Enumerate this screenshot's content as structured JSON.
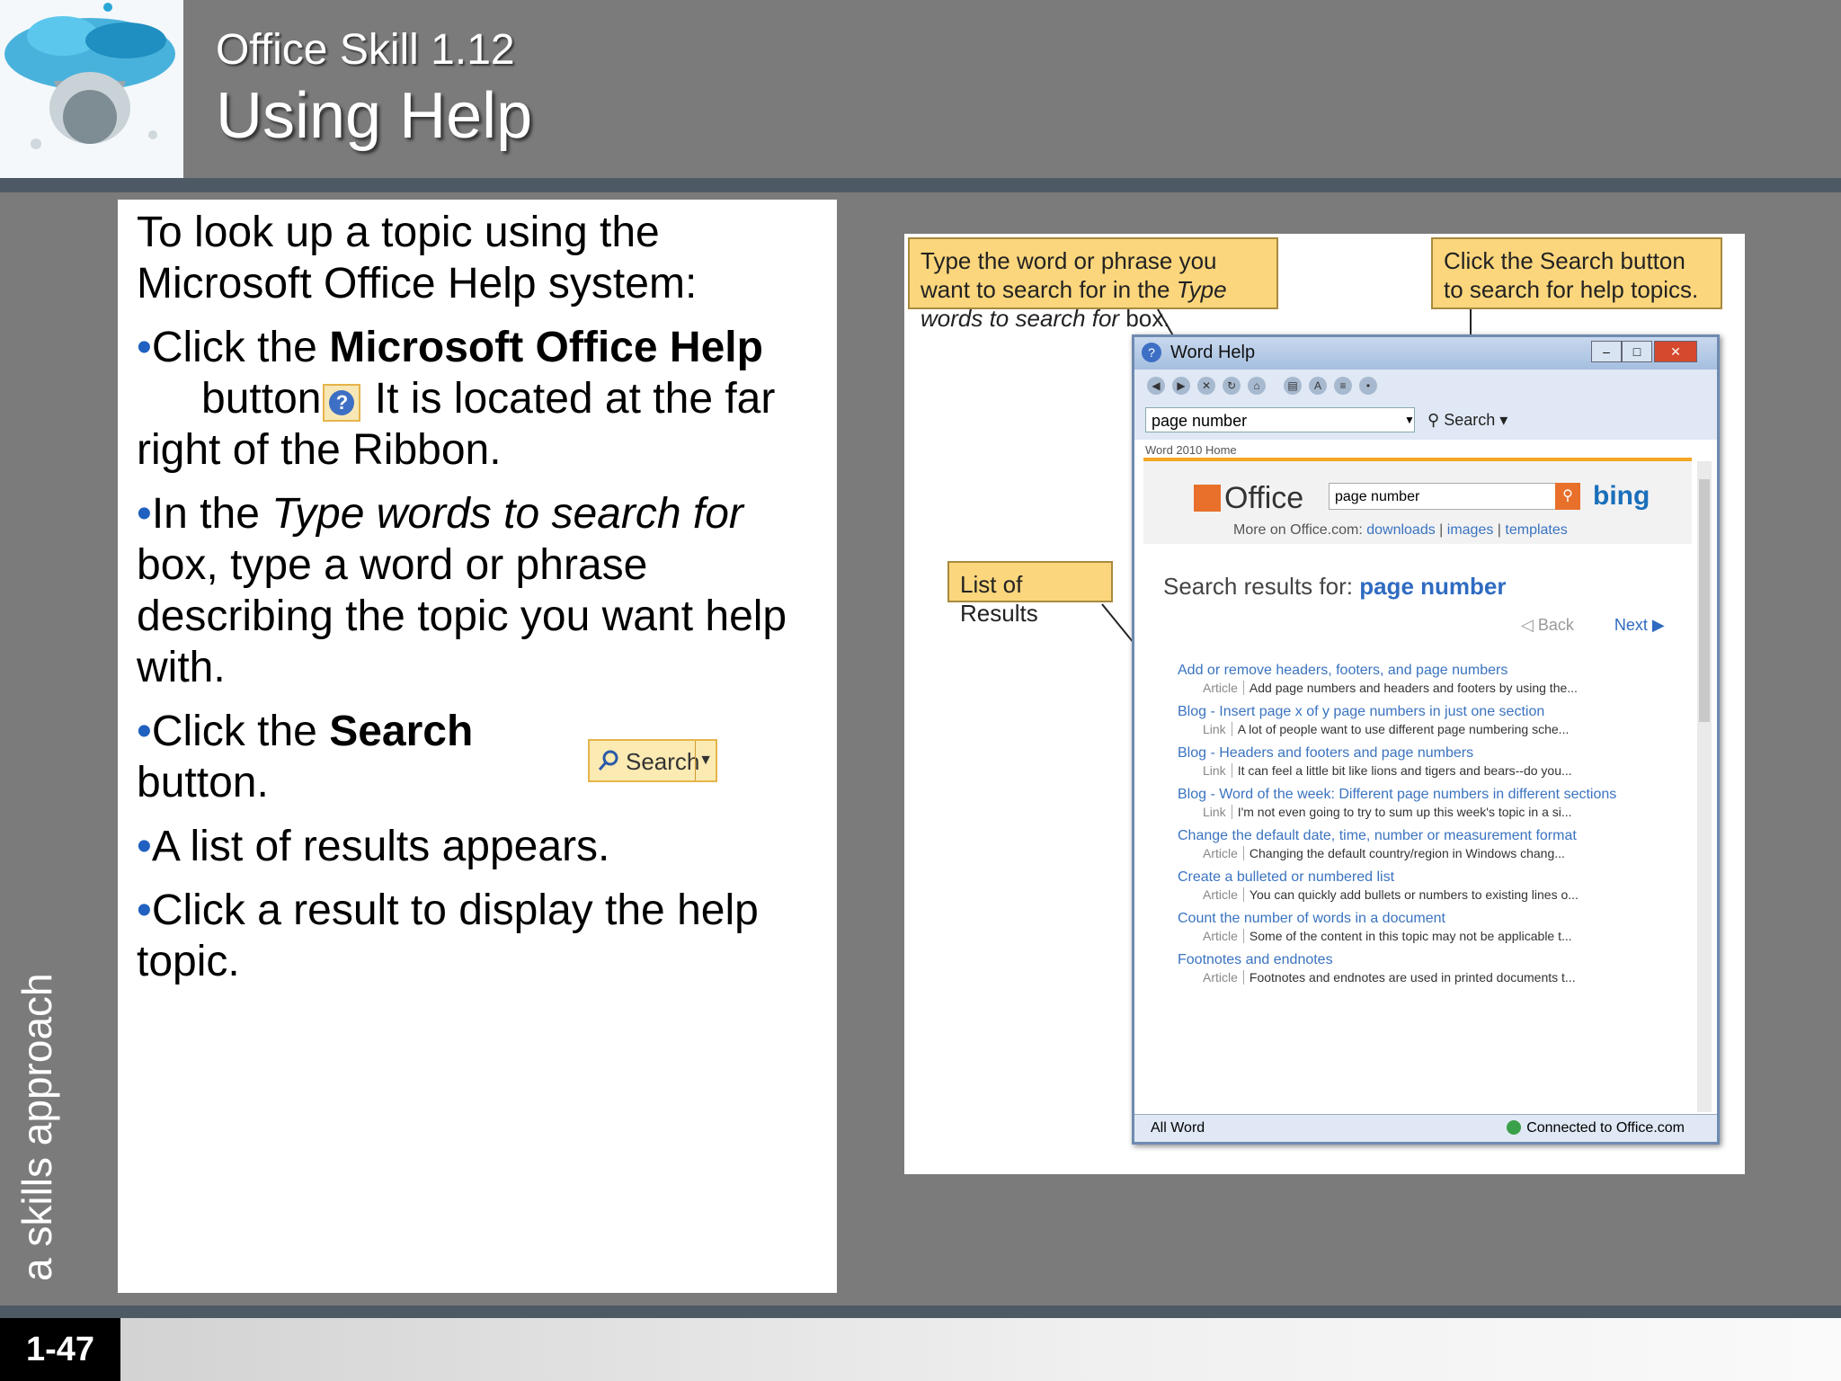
{
  "header": {
    "subtitle": "Office Skill 1.12",
    "title": "Using Help"
  },
  "side_text": "a skills approach",
  "page_number": "1-47",
  "content": {
    "intro": "To look up a topic using the Microsoft Office Help system:",
    "b1": {
      "pre": "Click the ",
      "bold": "Microsoft Office Help",
      "mid": " button",
      "post": " It is located at the far right of the Ribbon."
    },
    "b2": {
      "pre": "In the ",
      "italic": "Type words to search for",
      "post": " box, type a word or phrase describing the topic you want help with."
    },
    "b3": {
      "pre": "Click the ",
      "bold": "Search",
      "post": " button."
    },
    "b4": "A list of results appears.",
    "b5": "Click a result to display the help topic.",
    "search_button_label": "Search"
  },
  "callouts": {
    "type_words_pre": "Type the word or phrase you want to search for in the ",
    "type_words_italic": "Type words to search for",
    "type_words_post": " box.",
    "search_button": "Click the Search button to search for help topics.",
    "list_results": "List of Results"
  },
  "window": {
    "title": "Word Help",
    "search_value": "page number",
    "search_label": "Search",
    "breadcrumb": "Word 2010 Home",
    "office_logo": "Office",
    "office_search_value": "page number",
    "bing": "bing",
    "more_label": "More on Office.com:",
    "more_links": [
      "downloads",
      "images",
      "templates"
    ],
    "results_label": "Search results for:",
    "results_query": "page number",
    "back": "Back",
    "next": "Next",
    "results": [
      {
        "title": "Add or remove headers, footers, and page numbers",
        "kind": "Article",
        "desc": "Add page numbers and headers and footers by using the..."
      },
      {
        "title": "Blog - Insert page x of y page numbers in just one section",
        "kind": "Link",
        "desc": "A lot of people want to use different page numbering sche..."
      },
      {
        "title": "Blog - Headers and footers and page numbers",
        "kind": "Link",
        "desc": "It can feel a little bit like lions and tigers and bears--do you..."
      },
      {
        "title": "Blog - Word of the week: Different page numbers in different sections",
        "kind": "Link",
        "desc": "I'm not even going to try to sum up this week's topic in a si..."
      },
      {
        "title": "Change the default date, time, number or measurement format",
        "kind": "Article",
        "desc": "Changing the default country/region in Windows chang..."
      },
      {
        "title": "Create a bulleted or numbered list",
        "kind": "Article",
        "desc": "You can quickly add bullets or numbers to existing lines o..."
      },
      {
        "title": "Count the number of words in a document",
        "kind": "Article",
        "desc": "Some of the content in this topic may not be applicable t..."
      },
      {
        "title": "Footnotes and endnotes",
        "kind": "Article",
        "desc": "Footnotes and endnotes are used in printed documents t..."
      }
    ],
    "status_left": "All Word",
    "status_right": "Connected to Office.com"
  }
}
